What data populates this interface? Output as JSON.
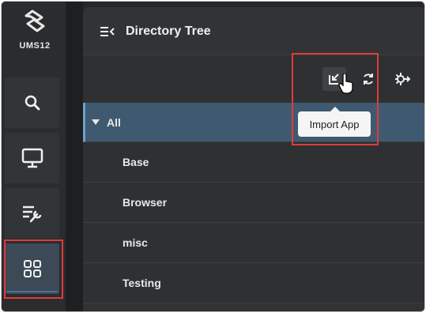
{
  "app": {
    "logo_text": "UMS12"
  },
  "panel": {
    "title": "Directory Tree"
  },
  "toolbar": {
    "import_tooltip": "Import App",
    "buttons": [
      "import-app",
      "refresh",
      "settings-arrow"
    ]
  },
  "tree": {
    "root": "All",
    "items": [
      "Base",
      "Browser",
      "misc",
      "Testing"
    ]
  },
  "colors": {
    "sidebar_bg": "#2a2c2e",
    "panel_bg": "#303234",
    "selected_row": "#3f5a70",
    "highlight_box": "#e03b3b"
  }
}
